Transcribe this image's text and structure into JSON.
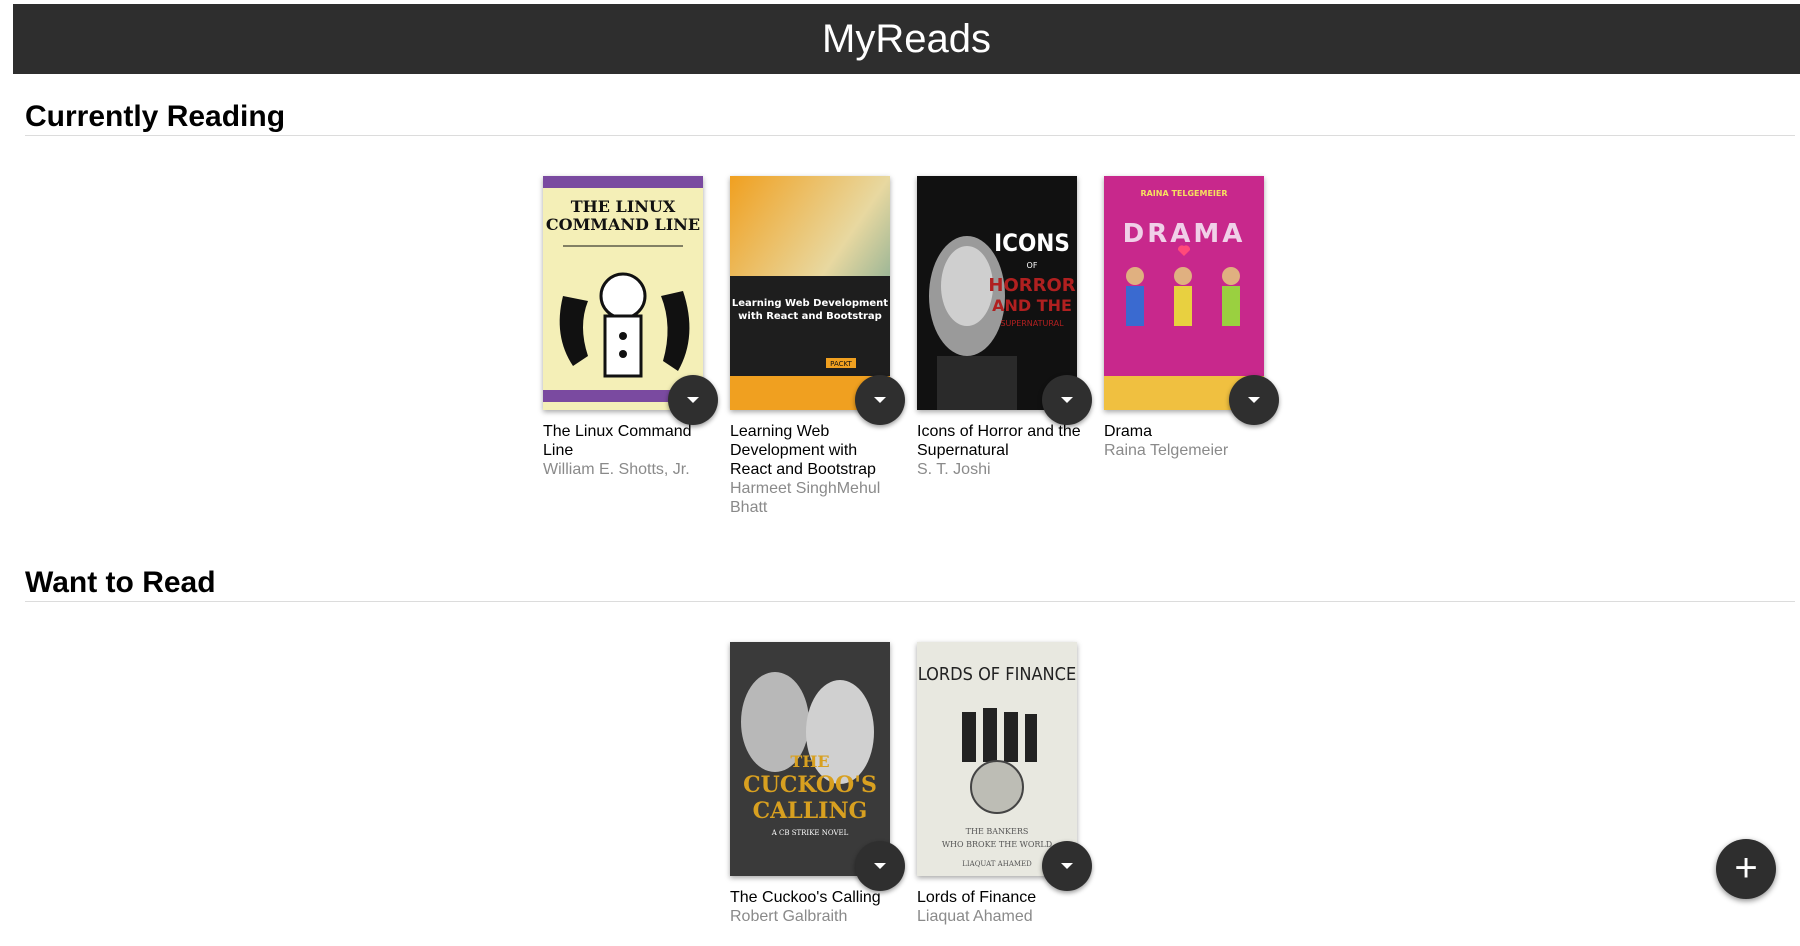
{
  "app": {
    "title": "MyReads"
  },
  "shelves": [
    {
      "title": "Currently Reading",
      "books": [
        {
          "title": "The Linux Command Line",
          "authors": "William E. Shotts, Jr.",
          "cover_text": [
            "THE LINUX",
            "COMMAND LINE"
          ]
        },
        {
          "title": "Learning Web Development with React and Bootstrap",
          "authors": "Harmeet SinghMehul Bhatt",
          "cover_text": [
            "Learning Web Development",
            "with React and Bootstrap",
            "PACKT"
          ]
        },
        {
          "title": "Icons of Horror and the Supernatural",
          "authors": "S. T. Joshi",
          "cover_text": [
            "ICONS",
            "OF",
            "HORROR",
            "AND THE",
            "SUPERNATURAL"
          ]
        },
        {
          "title": "Drama",
          "authors": "Raina Telgemeier",
          "cover_text": [
            "RAINA TELGEMEIER",
            "DRAMA"
          ]
        }
      ]
    },
    {
      "title": "Want to Read",
      "books": [
        {
          "title": "The Cuckoo's Calling",
          "authors": "Robert Galbraith",
          "cover_text": [
            "THE",
            "CUCKOO'S",
            "CALLING",
            "A CB STRIKE NOVEL"
          ]
        },
        {
          "title": "Lords of Finance",
          "authors": "Liaquat Ahamed",
          "cover_text": [
            "LORDS OF FINANCE",
            "THE BANKERS",
            "WHO BROKE THE WORLD",
            "LIAQUAT AHAMED"
          ]
        }
      ]
    }
  ],
  "colors": {
    "header_bg": "#2e2e2e",
    "button_bg": "#2f2f2f",
    "author_text": "#8a8a8a"
  },
  "icons": {
    "shelf_changer": "caret-down-icon",
    "add": "plus-icon"
  },
  "add_button": {
    "label": "+"
  }
}
